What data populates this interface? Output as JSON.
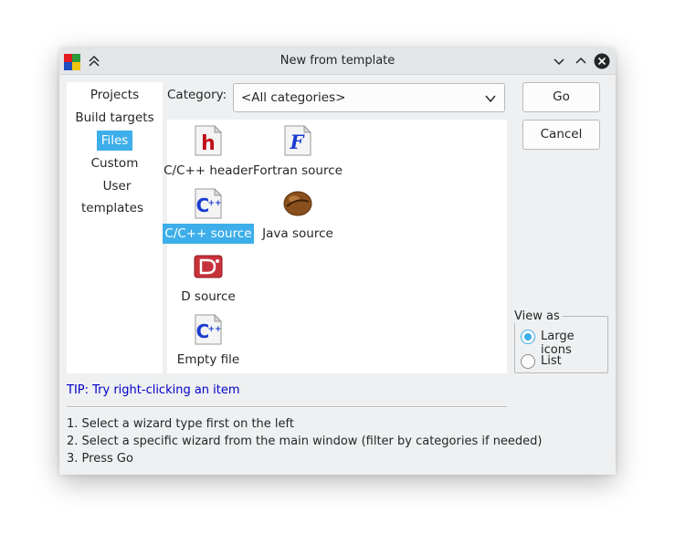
{
  "window": {
    "title": "New from template"
  },
  "sidebar": {
    "items": [
      {
        "label": "Projects",
        "selected": false
      },
      {
        "label": "Build targets",
        "selected": false
      },
      {
        "label": "Files",
        "selected": true
      },
      {
        "label": "Custom",
        "selected": false
      },
      {
        "label": "User templates",
        "selected": false
      }
    ]
  },
  "category": {
    "label": "Category:",
    "value": "<All categories>"
  },
  "templates": [
    {
      "label": "C/C++ header",
      "icon": "c-header-file-icon",
      "selected": false
    },
    {
      "label": "Fortran source",
      "icon": "fortran-file-icon",
      "selected": false
    },
    {
      "label": "C/C++ source",
      "icon": "cpp-source-file-icon",
      "selected": true
    },
    {
      "label": "Java source",
      "icon": "java-coffee-bean-icon",
      "selected": false
    },
    {
      "label": "D source",
      "icon": "d-source-file-icon",
      "selected": false
    },
    {
      "label": "Empty file",
      "icon": "empty-cpp-file-icon",
      "selected": false
    }
  ],
  "buttons": {
    "go": "Go",
    "cancel": "Cancel"
  },
  "view_as": {
    "label": "View as",
    "options": [
      {
        "label": "Large icons",
        "checked": true
      },
      {
        "label": "List",
        "checked": false
      }
    ]
  },
  "tip": "TIP: Try right-clicking an item",
  "instructions": [
    "1. Select a wizard type first on the left",
    "2. Select a specific wizard from the main window (filter by categories if needed)",
    "3. Press Go"
  ],
  "colors": {
    "accent": "#3daee9",
    "tip": "#0000c8",
    "window_bg": "#eff0f1"
  }
}
